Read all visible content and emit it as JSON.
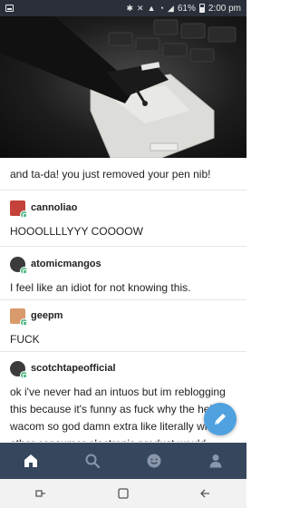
{
  "status_bar": {
    "battery_percent": "61%",
    "time": "2:00 pm"
  },
  "post": {
    "caption": "and ta-da! you just removed your pen nib!"
  },
  "reblogs": [
    {
      "username": "cannoliao",
      "text": "HOOOLLLLYYY COOOOW",
      "avatar_color": "#c4423a"
    },
    {
      "username": "atomicmangos",
      "text": "I feel like an idiot for not knowing this.",
      "avatar_color": "#3b3b3b"
    },
    {
      "username": "geepm",
      "text": "FUCK",
      "avatar_color": "#d99a6c"
    },
    {
      "username": "scotchtapeofficial",
      "text": "ok i've never had an intuos but im reblogging this because it's funny as fuck why the hell is wacom so god damn extra like literally wh... other consumer electronic product would",
      "avatar_color": "#3b3b3b"
    }
  ],
  "colors": {
    "app_nav_bg": "#36465d",
    "fab_bg": "#4fa1e0",
    "badge": "#56bc8a"
  },
  "icons": {
    "nav": [
      "home-icon",
      "search-icon",
      "smiley-icon",
      "account-icon"
    ],
    "system": [
      "recent-apps-icon",
      "home-square-icon",
      "back-icon"
    ]
  }
}
